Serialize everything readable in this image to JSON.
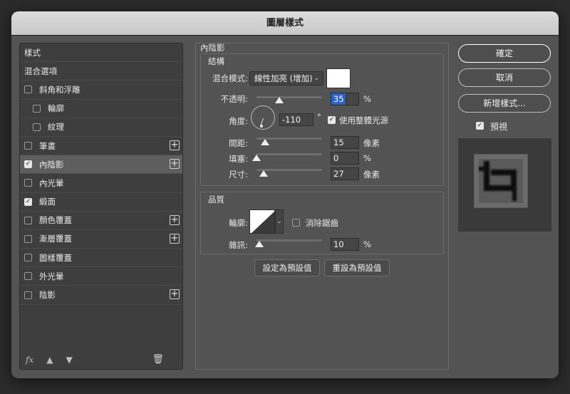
{
  "window": {
    "title": "圖層樣式"
  },
  "left_panel": {
    "items": [
      {
        "label": "樣式",
        "checkbox": false,
        "checked": false,
        "plus": false,
        "indent": false,
        "selected": false
      },
      {
        "label": "混合選項",
        "checkbox": false,
        "checked": false,
        "plus": false,
        "indent": false,
        "selected": false
      },
      {
        "label": "斜角和浮雕",
        "checkbox": true,
        "checked": false,
        "plus": false,
        "indent": false,
        "selected": false
      },
      {
        "label": "輪廓",
        "checkbox": true,
        "checked": false,
        "plus": false,
        "indent": true,
        "selected": false
      },
      {
        "label": "紋理",
        "checkbox": true,
        "checked": false,
        "plus": false,
        "indent": true,
        "selected": false
      },
      {
        "label": "筆畫",
        "checkbox": true,
        "checked": false,
        "plus": true,
        "indent": false,
        "selected": false
      },
      {
        "label": "內陰影",
        "checkbox": true,
        "checked": true,
        "plus": true,
        "indent": false,
        "selected": true
      },
      {
        "label": "內光暈",
        "checkbox": true,
        "checked": false,
        "plus": false,
        "indent": false,
        "selected": false
      },
      {
        "label": "緞面",
        "checkbox": true,
        "checked": true,
        "plus": false,
        "indent": false,
        "selected": false
      },
      {
        "label": "顏色覆蓋",
        "checkbox": true,
        "checked": false,
        "plus": true,
        "indent": false,
        "selected": false
      },
      {
        "label": "漸層覆蓋",
        "checkbox": true,
        "checked": false,
        "plus": true,
        "indent": false,
        "selected": false
      },
      {
        "label": "圖樣覆蓋",
        "checkbox": true,
        "checked": false,
        "plus": false,
        "indent": false,
        "selected": false
      },
      {
        "label": "外光暈",
        "checkbox": true,
        "checked": false,
        "plus": false,
        "indent": false,
        "selected": false
      },
      {
        "label": "陰影",
        "checkbox": true,
        "checked": false,
        "plus": true,
        "indent": false,
        "selected": false
      }
    ],
    "footer": {
      "fx": "fx",
      "up_icon": "arrow-up-icon",
      "down_icon": "arrow-down-icon",
      "trash_icon": "trash-icon"
    }
  },
  "inner_shadow": {
    "title": "內陰影",
    "structure": {
      "title": "結構",
      "blend_mode_label": "混合模式:",
      "blend_mode_value": "線性加亮 (增加)",
      "color": "#ffffff",
      "opacity_label": "不透明:",
      "opacity_value": "35",
      "opacity_unit": "%",
      "opacity_level": 0.35,
      "angle_label": "角度:",
      "angle_value": "-110",
      "angle_unit": "°",
      "global_light_label": "使用整體光源",
      "global_light_checked": true,
      "distance_label": "間距:",
      "distance_value": "15",
      "distance_unit": "像素",
      "choke_label": "填塞:",
      "choke_value": "0",
      "choke_unit": "%",
      "size_label": "尺寸:",
      "size_value": "27",
      "size_unit": "像素"
    },
    "quality": {
      "title": "品質",
      "contour_label": "輪廓:",
      "antialias_label": "消除鋸齒",
      "antialias_checked": false,
      "noise_label": "雜訊:",
      "noise_value": "10",
      "noise_unit": "%"
    },
    "buttons": {
      "set_default": "設定為預設值",
      "reset_default": "重設為預設值"
    }
  },
  "right_panel": {
    "ok": "確定",
    "cancel": "取消",
    "new_style": "新增樣式...",
    "preview_label": "預視",
    "preview_checked": true
  }
}
